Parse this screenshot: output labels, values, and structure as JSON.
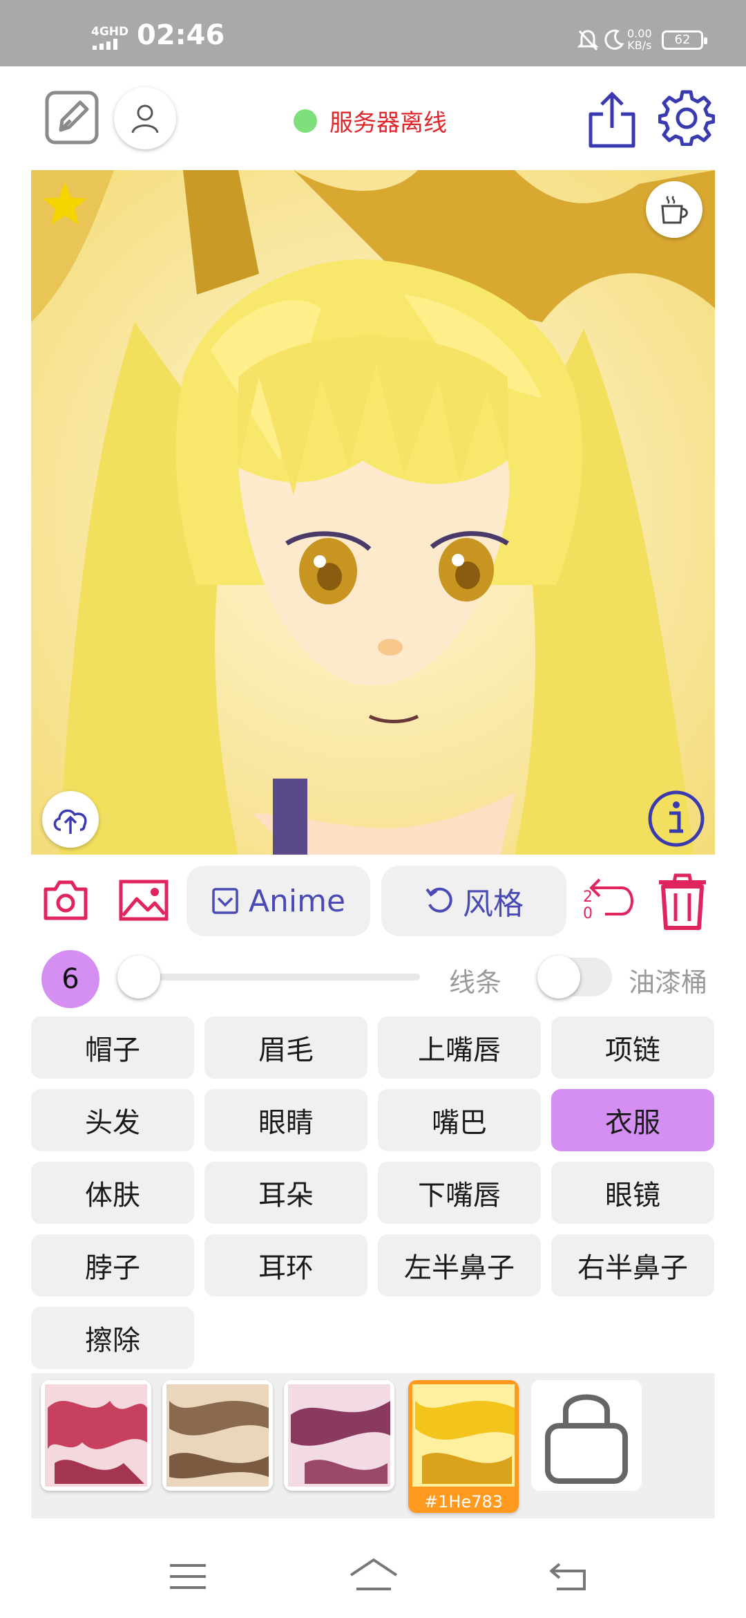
{
  "status_bar": {
    "network": "4GHD",
    "time": "02:46",
    "speed_value": "0.00",
    "speed_unit": "KB/s",
    "battery": "62"
  },
  "header": {
    "server_status": "服务器离线",
    "server_dot_color": "#7de07a",
    "icons": [
      "edit-square-icon",
      "user-icon",
      "share-icon",
      "settings-gear-icon"
    ]
  },
  "canvas": {
    "star_color": "#f5d400",
    "icons": [
      "star-icon",
      "coffee-cup-icon",
      "cloud-upload-icon",
      "info-icon"
    ]
  },
  "toolbar": {
    "model_label": "Anime",
    "style_label": "风格",
    "undo_top": "2",
    "undo_bottom": "0",
    "icons": [
      "camera-icon",
      "image-icon",
      "checkbox-icon",
      "refresh-icon",
      "undo-icon",
      "trash-icon"
    ]
  },
  "brush": {
    "size": "6",
    "size_slider_level": 0.0,
    "lines_label": "线条",
    "bucket_label": "油漆桶",
    "bucket_enabled": false
  },
  "labels": [
    {
      "text": "帽子",
      "selected": false
    },
    {
      "text": "眉毛",
      "selected": false
    },
    {
      "text": "上嘴唇",
      "selected": false
    },
    {
      "text": "项链",
      "selected": false
    },
    {
      "text": "头发",
      "selected": false
    },
    {
      "text": "眼睛",
      "selected": false
    },
    {
      "text": "嘴巴",
      "selected": false
    },
    {
      "text": "衣服",
      "selected": true
    },
    {
      "text": "体肤",
      "selected": false
    },
    {
      "text": "耳朵",
      "selected": false
    },
    {
      "text": "下嘴唇",
      "selected": false
    },
    {
      "text": "眼镜",
      "selected": false
    },
    {
      "text": "脖子",
      "selected": false
    },
    {
      "text": "耳环",
      "selected": false
    },
    {
      "text": "左半鼻子",
      "selected": false
    },
    {
      "text": "右半鼻子",
      "selected": false
    },
    {
      "text": "擦除",
      "selected": false
    }
  ],
  "swatches": {
    "selected_tag": "#1He783",
    "accent": "#ff9a1e",
    "icons": [
      "shopping-bag-icon"
    ]
  },
  "nav": {
    "icons": [
      "menu-icon",
      "home-icon",
      "back-icon"
    ]
  }
}
